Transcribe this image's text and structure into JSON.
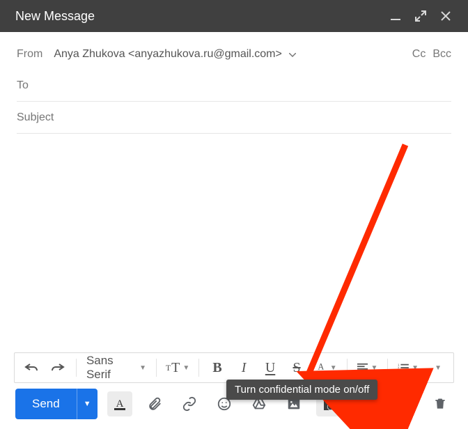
{
  "titlebar": {
    "title": "New Message"
  },
  "header": {
    "from_label": "From",
    "from_value": "Anya Zhukova <anyazhukova.ru@gmail.com>",
    "cc_label": "Cc",
    "bcc_label": "Bcc",
    "to_label": "To",
    "subject_placeholder": "Subject"
  },
  "format": {
    "font_family": "Sans Serif",
    "bold": "B",
    "italic": "I",
    "underline": "U",
    "strike": "S"
  },
  "tooltip": "Turn confidential mode on/off",
  "actions": {
    "send_label": "Send"
  }
}
